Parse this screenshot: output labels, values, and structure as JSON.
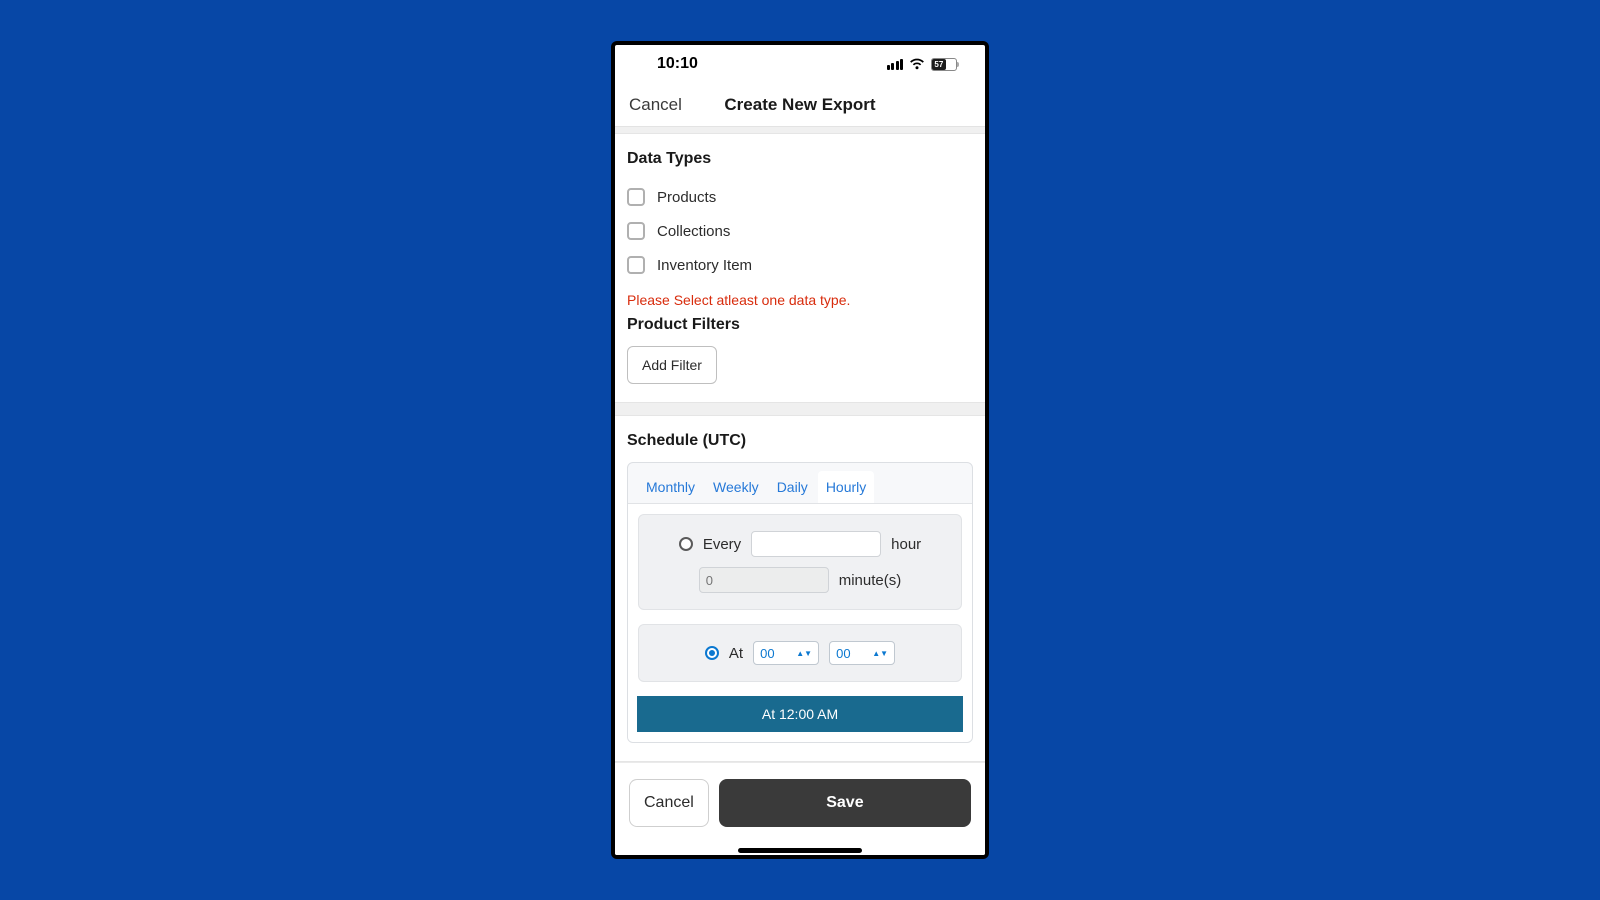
{
  "status": {
    "time": "10:10",
    "battery_pct": "57"
  },
  "nav": {
    "cancel": "Cancel",
    "title": "Create New Export"
  },
  "data_types": {
    "title": "Data Types",
    "items": [
      "Products",
      "Collections",
      "Inventory Item"
    ],
    "error": "Please Select atleast one data type."
  },
  "filters": {
    "title": "Product Filters",
    "add_button": "Add Filter"
  },
  "schedule": {
    "title": "Schedule (UTC)",
    "tabs": [
      "Monthly",
      "Weekly",
      "Daily",
      "Hourly"
    ],
    "active_tab": "Hourly",
    "every": {
      "label_before": "Every",
      "label_after": "hour",
      "minutes_placeholder": "0",
      "minutes_after": "minute(s)"
    },
    "at": {
      "label": "At",
      "hour": "00",
      "minute": "00"
    },
    "summary": "At 12:00 AM"
  },
  "footer": {
    "cancel": "Cancel",
    "save": "Save"
  }
}
